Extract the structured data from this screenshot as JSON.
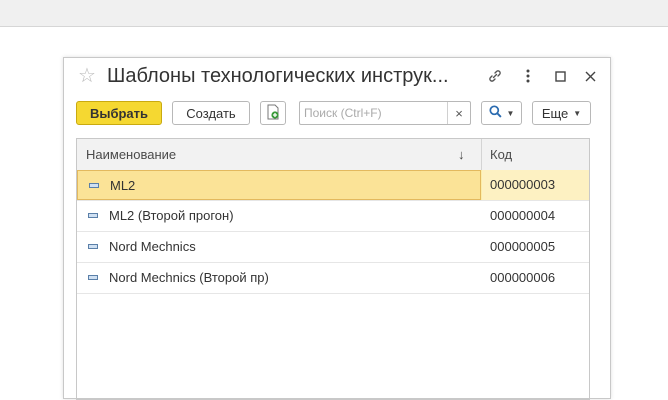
{
  "window": {
    "title": "Шаблоны технологических инструк..."
  },
  "toolbar": {
    "select_label": "Выбрать",
    "create_label": "Создать",
    "more_label": "Еще"
  },
  "search": {
    "placeholder": "Поиск (Ctrl+F)",
    "value": "",
    "clear_glyph": "×"
  },
  "table": {
    "columns": [
      "Наименование",
      "Код"
    ],
    "sort_glyph": "↓",
    "rows": [
      {
        "name": "ML2",
        "code": "000000003",
        "selected": true
      },
      {
        "name": "ML2 (Второй прогон)",
        "code": "000000004"
      },
      {
        "name": "Nord Mechnics",
        "code": "000000005"
      },
      {
        "name": "Nord Mechnics (Второй пр)",
        "code": "000000006"
      }
    ]
  },
  "icons": [
    "star-icon",
    "link-icon",
    "more-vertical-icon",
    "maximize-icon",
    "close-icon",
    "new-file-icon",
    "search-icon",
    "chevron-down-icon",
    "list-item-icon"
  ],
  "colors": {
    "accent": "#f5d831",
    "selection": "#fbe397"
  }
}
